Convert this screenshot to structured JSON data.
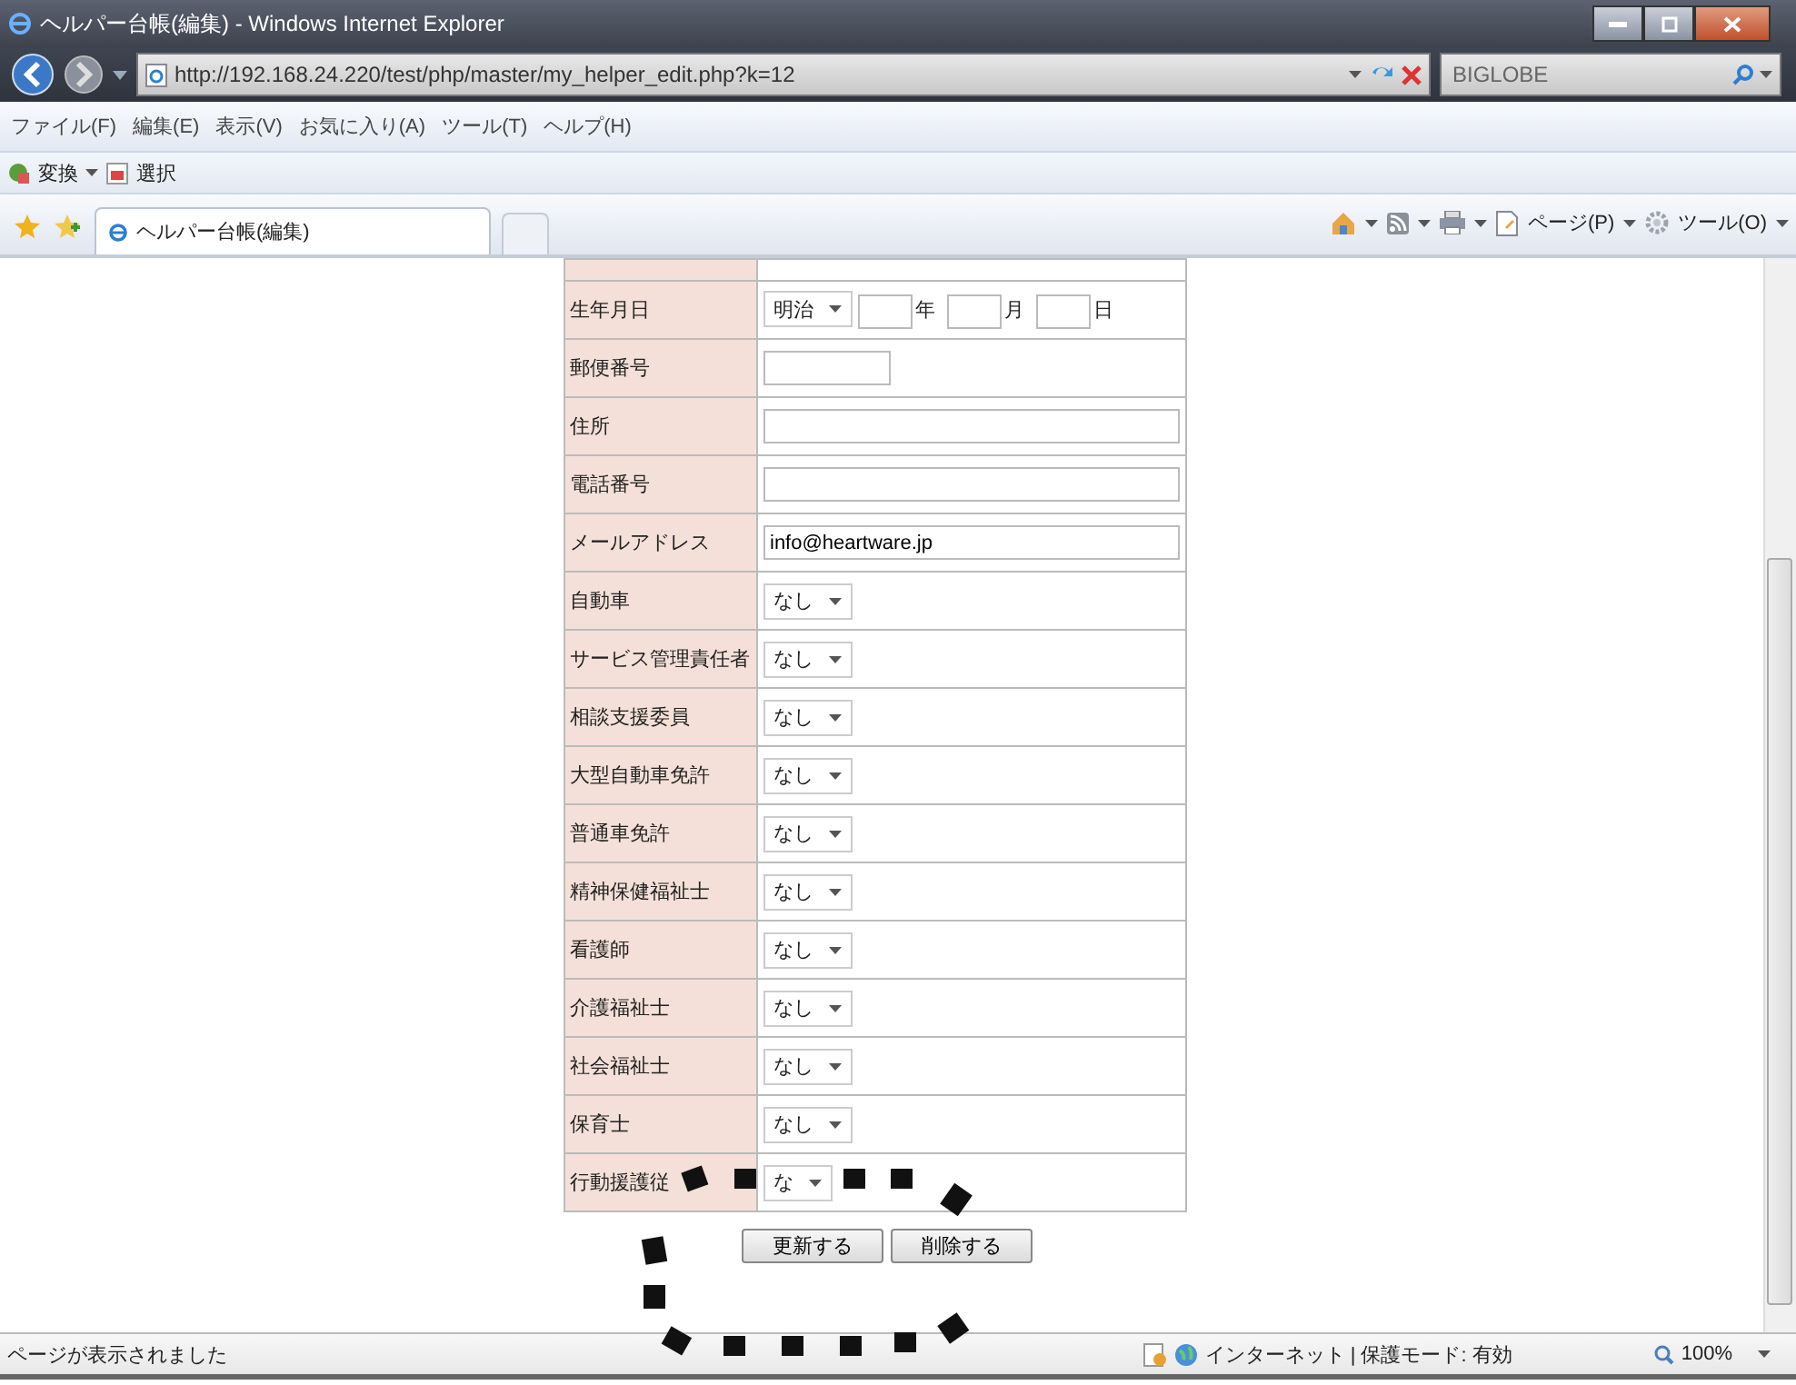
{
  "window": {
    "title": "ヘルパー台帳(編集) - Windows Internet Explorer"
  },
  "address_bar": {
    "url": "http://192.168.24.220/test/php/master/my_helper_edit.php?k=12"
  },
  "search": {
    "placeholder": "BIGLOBE"
  },
  "menu": [
    "ファイル(F)",
    "編集(E)",
    "表示(V)",
    "お気に入り(A)",
    "ツール(T)",
    "ヘルプ(H)"
  ],
  "command_bar": [
    "変換",
    "選択"
  ],
  "tab": {
    "title": "ヘルパー台帳(編集)"
  },
  "toolbar": [
    "ページ(P)",
    "ツール(O)"
  ],
  "form": {
    "rows": [
      {
        "label": "生年月日",
        "kind": "date",
        "era": "明治",
        "year_unit": "年",
        "month_unit": "月",
        "day_unit": "日"
      },
      {
        "label": "郵便番号",
        "kind": "short_text"
      },
      {
        "label": "住所",
        "kind": "text"
      },
      {
        "label": "電話番号",
        "kind": "text"
      },
      {
        "label": "メールアドレス",
        "kind": "text",
        "value": "info@heartware.jp"
      },
      {
        "label": "自動車",
        "kind": "select",
        "value": "なし"
      },
      {
        "label": "サービス管理責任者",
        "kind": "select",
        "value": "なし"
      },
      {
        "label": "相談支援委員",
        "kind": "select",
        "value": "なし"
      },
      {
        "label": "大型自動車免許",
        "kind": "select",
        "value": "なし"
      },
      {
        "label": "普通車免許",
        "kind": "select",
        "value": "なし"
      },
      {
        "label": "精神保健福祉士",
        "kind": "select",
        "value": "なし"
      },
      {
        "label": "看護師",
        "kind": "select",
        "value": "なし"
      },
      {
        "label": "介護福祉士",
        "kind": "select",
        "value": "なし"
      },
      {
        "label": "社会福祉士",
        "kind": "select",
        "value": "なし"
      },
      {
        "label": "保育士",
        "kind": "select",
        "value": "なし"
      },
      {
        "label": "行動援護従",
        "kind": "select",
        "value": "な"
      }
    ]
  },
  "buttons": [
    "更新する",
    "削除する"
  ],
  "status_bar": {
    "message": "ページが表示されました",
    "zone": "インターネット | 保護モード: 有効",
    "zoom": "100%"
  }
}
